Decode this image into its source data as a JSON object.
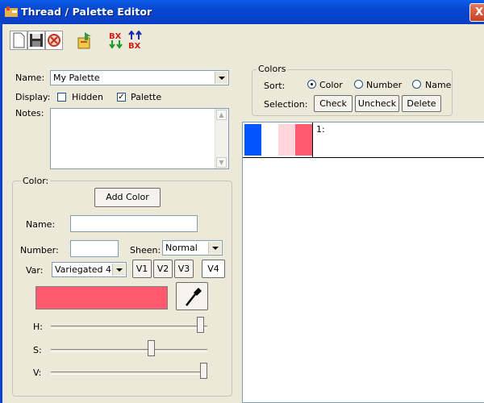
{
  "window": {
    "title": "Thread / Palette Editor",
    "close_glyph": "X"
  },
  "toolbar": {
    "buttons": [
      "new-icon",
      "save-icon",
      "delete-icon",
      "import-icon",
      "bx-down-icon",
      "bx-up-icon"
    ],
    "bx_text": "BX"
  },
  "name": {
    "label": "Name:",
    "value": "My Palette"
  },
  "display": {
    "label": "Display:",
    "hidden_label": "Hidden",
    "hidden_checked": false,
    "palette_label": "Palette",
    "palette_checked": true
  },
  "notes": {
    "label": "Notes:",
    "value": ""
  },
  "colors_group": {
    "title": "Colors",
    "sort_label": "Sort:",
    "sort_options": [
      "Color",
      "Number",
      "Name"
    ],
    "sort_selected": "Color",
    "selection_label": "Selection:",
    "check_button": "Check",
    "uncheck_button": "Uncheck",
    "delete_button": "Delete"
  },
  "palette_list": {
    "items": [
      {
        "number": "1:",
        "swatches": [
          "#0055FF",
          "#FFFFFF",
          "#FFD6DC",
          "#FF5A6E"
        ]
      }
    ]
  },
  "color_group": {
    "title": "Color:",
    "add_color_button": "Add Color",
    "name_label": "Name:",
    "name_value": "",
    "number_label": "Number:",
    "number_value": "",
    "sheen_label": "Sheen:",
    "sheen_value": "Normal",
    "var_label": "Var:",
    "var_value": "Variegated 4",
    "var_buttons": [
      "V1",
      "V2",
      "V3",
      "V4"
    ],
    "selected_var": "V4",
    "swatch_color": "#FF5A6E",
    "h_label": "H:",
    "s_label": "S:",
    "v_label": "V:",
    "h_value": 0.98,
    "s_value": 0.65,
    "v_value": 1.0
  },
  "colors": {
    "titlebar": "#0A46CF",
    "accent": "#FF5A6E",
    "face": "#ECE9D8"
  }
}
